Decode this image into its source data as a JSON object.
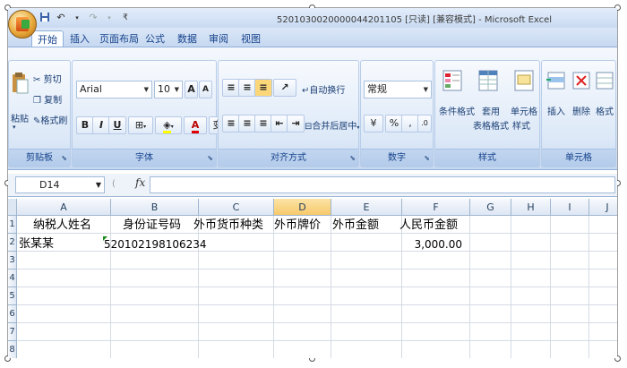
{
  "window": {
    "title": "5201030020000044201105  [只读]  [兼容模式] - Microsoft Excel"
  },
  "quick_access": {
    "save_icon": "save-icon",
    "undo_icon": "undo-icon",
    "redo_icon": "redo-icon"
  },
  "tabs": [
    {
      "label": "开始",
      "active": true
    },
    {
      "label": "插入"
    },
    {
      "label": "页面布局"
    },
    {
      "label": "公式"
    },
    {
      "label": "数据"
    },
    {
      "label": "审阅"
    },
    {
      "label": "视图"
    }
  ],
  "ribbon": {
    "clipboard": {
      "paste": "粘贴",
      "cut": "剪切",
      "copy": "复制",
      "format_painter": "格式刷",
      "label": "剪贴板"
    },
    "font": {
      "name": "Arial",
      "size": "10",
      "bold": "B",
      "italic": "I",
      "underline": "U",
      "font_color": "A",
      "phonetic": "变",
      "grow": "A",
      "shrink": "A",
      "label": "字体"
    },
    "alignment": {
      "wrap_text": "自动换行",
      "merge_center": "合并后居中",
      "label": "对齐方式"
    },
    "number": {
      "format": "常规",
      "percent": "%",
      "comma": ",",
      "label": "数字"
    },
    "styles": {
      "conditional": "条件格式",
      "table_format_1": "套用",
      "table_format_2": "表格格式",
      "cell_style_1": "单元格",
      "cell_style_2": "样式",
      "label": "样式"
    },
    "cells": {
      "insert": "插入",
      "delete": "删除",
      "format": "格式",
      "label": "单元格"
    }
  },
  "formula_bar": {
    "name_box": "D14",
    "fx": "fx",
    "value": ""
  },
  "sheet": {
    "columns": [
      "A",
      "B",
      "C",
      "D",
      "E",
      "F",
      "G",
      "H",
      "I",
      "J"
    ],
    "selected_column": "D",
    "rows": [
      "1",
      "2",
      "3",
      "4",
      "5",
      "6",
      "7",
      "8"
    ],
    "headers": [
      "纳税人姓名",
      "身份证号码",
      "外币货币种类",
      "外币牌价",
      "外币金额",
      "人民币金额"
    ],
    "data": {
      "name": "张某某",
      "id_number": "520102198106234",
      "rmb_amount": "3,000.00"
    }
  }
}
